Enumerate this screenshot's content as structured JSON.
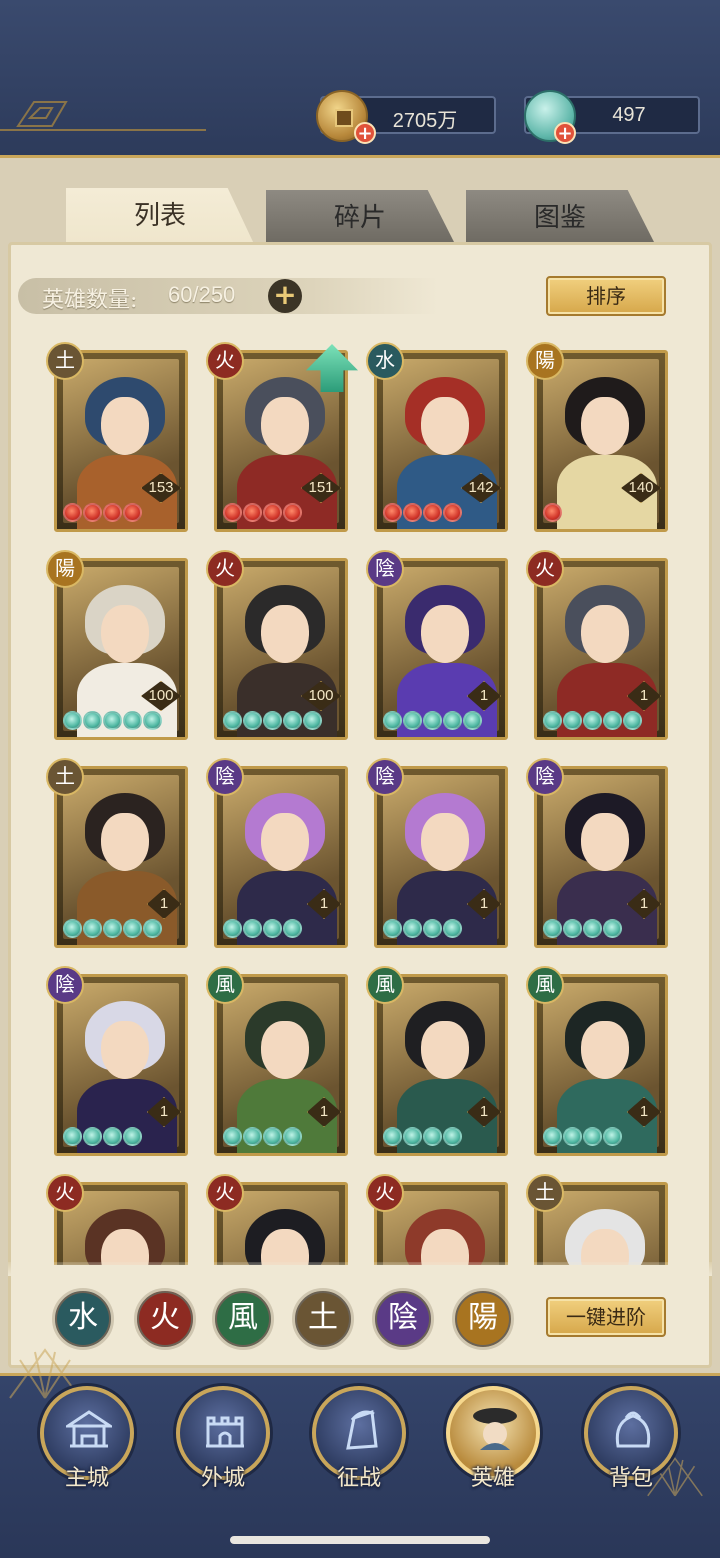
{
  "currencies": {
    "coins": {
      "icon": "copper-coin-icon",
      "value": "2705万"
    },
    "jade": {
      "icon": "jade-icon",
      "value": "497"
    }
  },
  "tabs": [
    {
      "label": "列表",
      "active": true
    },
    {
      "label": "碎片",
      "active": false
    },
    {
      "label": "图鉴",
      "active": false
    }
  ],
  "hero_count": {
    "label": "英雄数量:",
    "value": "60/250"
  },
  "sort_button": "排序",
  "heroes": [
    {
      "element": "土",
      "level": "153",
      "stars": 4,
      "star_color": "red",
      "palette": [
        "#2e4a6e",
        "#a8612c"
      ]
    },
    {
      "element": "火",
      "level": "151",
      "stars": 4,
      "star_color": "red",
      "palette": [
        "#4a4f5c",
        "#8e2a25"
      ],
      "upgradable": true
    },
    {
      "element": "水",
      "level": "142",
      "stars": 4,
      "star_color": "red",
      "palette": [
        "#a52f26",
        "#2f5a86"
      ]
    },
    {
      "element": "陽",
      "level": "140",
      "stars": 1,
      "star_color": "red",
      "palette": [
        "#1f1b1b",
        "#e5d7a3"
      ]
    },
    {
      "element": "陽",
      "level": "100",
      "stars": 5,
      "star_color": "jade",
      "palette": [
        "#dad4c6",
        "#f1ece2"
      ]
    },
    {
      "element": "火",
      "level": "100",
      "stars": 5,
      "star_color": "jade",
      "palette": [
        "#2b2a2a",
        "#3a2f2a"
      ]
    },
    {
      "element": "陰",
      "level": "1",
      "stars": 5,
      "star_color": "jade",
      "palette": [
        "#3a2b6e",
        "#5a3cb0"
      ]
    },
    {
      "element": "火",
      "level": "1",
      "stars": 5,
      "star_color": "jade",
      "palette": [
        "#4a4f5c",
        "#8e2a25"
      ]
    },
    {
      "element": "土",
      "level": "1",
      "stars": 5,
      "star_color": "jade",
      "palette": [
        "#2b2320",
        "#8a5a2a"
      ]
    },
    {
      "element": "陰",
      "level": "1",
      "stars": 4,
      "star_color": "jade",
      "palette": [
        "#b47ad1",
        "#2e2a4a"
      ]
    },
    {
      "element": "陰",
      "level": "1",
      "stars": 4,
      "star_color": "jade",
      "palette": [
        "#b47ad1",
        "#2e2a4a"
      ]
    },
    {
      "element": "陰",
      "level": "1",
      "stars": 4,
      "star_color": "jade",
      "palette": [
        "#1d1a26",
        "#3a2e4e"
      ]
    },
    {
      "element": "陰",
      "level": "1",
      "stars": 4,
      "star_color": "jade",
      "palette": [
        "#d8d8e6",
        "#2a234e"
      ]
    },
    {
      "element": "風",
      "level": "1",
      "stars": 4,
      "star_color": "jade",
      "palette": [
        "#2b3a2a",
        "#4f7a3a"
      ]
    },
    {
      "element": "風",
      "level": "1",
      "stars": 4,
      "star_color": "jade",
      "palette": [
        "#1f1f22",
        "#2a5a4e"
      ]
    },
    {
      "element": "風",
      "level": "1",
      "stars": 4,
      "star_color": "jade",
      "palette": [
        "#1d2624",
        "#2f6a5e"
      ]
    },
    {
      "element": "火",
      "level": "",
      "stars": 0,
      "star_color": "jade",
      "palette": [
        "#5a3324",
        "#7a4a34"
      ]
    },
    {
      "element": "火",
      "level": "",
      "stars": 0,
      "star_color": "jade",
      "palette": [
        "#1d1d22",
        "#3a3a44"
      ]
    },
    {
      "element": "火",
      "level": "",
      "stars": 0,
      "star_color": "jade",
      "palette": [
        "#8e3a2a",
        "#b05a2a"
      ]
    },
    {
      "element": "土",
      "level": "",
      "stars": 0,
      "star_color": "jade",
      "palette": [
        "#e4e4e4",
        "#6a5a4a"
      ]
    }
  ],
  "filters": [
    {
      "element": "水",
      "icon": "water-element-icon"
    },
    {
      "element": "火",
      "icon": "fire-element-icon"
    },
    {
      "element": "風",
      "icon": "wind-element-icon"
    },
    {
      "element": "土",
      "icon": "earth-element-icon"
    },
    {
      "element": "陰",
      "icon": "yin-element-icon"
    },
    {
      "element": "陽",
      "icon": "yang-element-icon"
    }
  ],
  "advance_button": "一键进阶",
  "nav": [
    {
      "label": "主城",
      "icon": "main-city-icon",
      "active": false
    },
    {
      "label": "外城",
      "icon": "outer-city-icon",
      "active": false
    },
    {
      "label": "征战",
      "icon": "campaign-icon",
      "active": false
    },
    {
      "label": "英雄",
      "icon": "hero-icon",
      "active": true
    },
    {
      "label": "背包",
      "icon": "backpack-icon",
      "active": false
    }
  ],
  "colors": {
    "accent_gold": "#c9a65a",
    "nav_bg": "#2c3a5a",
    "panel_bg": "#efe8d4",
    "star_red": "#d1352a",
    "star_jade": "#4fb7a2"
  }
}
